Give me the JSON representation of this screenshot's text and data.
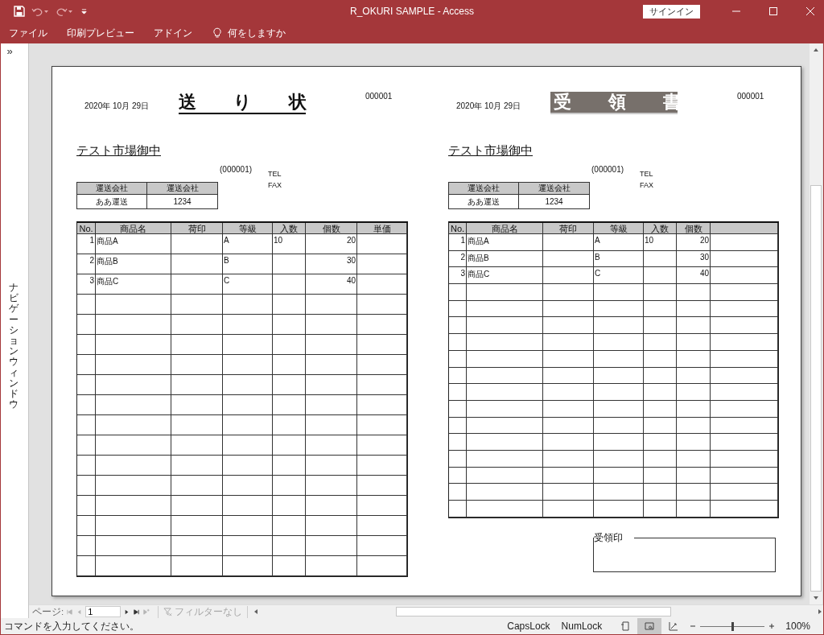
{
  "window": {
    "title": "R_OKURI SAMPLE  -  Access",
    "sign_in": "サインイン"
  },
  "menu": [
    {
      "label": "ファイル"
    },
    {
      "label": "印刷プレビュー"
    },
    {
      "label": "アドイン"
    }
  ],
  "tell_me": "何をしますか",
  "navigation_pane": {
    "toggle": "»",
    "label": "ナビゲーションウィンドウ"
  },
  "report": {
    "sheets": [
      {
        "kind": "invoice",
        "date": "2020年 10月 29日",
        "title": "送り状",
        "number": "000001",
        "recipient": "テスト市場御中",
        "code": "(000001)",
        "tel": "TEL",
        "fax": "FAX",
        "carrier": {
          "columns": [
            "運送会社",
            "運送会社"
          ],
          "values": [
            "ああ運送",
            "1234"
          ]
        },
        "items": {
          "columns": [
            "No.",
            "商品名",
            "荷印",
            "等級",
            "入数",
            "個数",
            "単価"
          ],
          "rows": [
            {
              "no": "1",
              "name": "商品A",
              "grade": "A",
              "qty": "10",
              "count": "20"
            },
            {
              "no": "2",
              "name": "商品B",
              "grade": "B",
              "count": "30"
            },
            {
              "no": "3",
              "name": "商品C",
              "grade": "C",
              "count": "40"
            },
            {},
            {},
            {},
            {},
            {},
            {},
            {},
            {},
            {},
            {},
            {},
            {},
            {},
            {}
          ]
        }
      },
      {
        "kind": "receipt",
        "date": "2020年 10月 29日",
        "title": "受領書",
        "number": "000001",
        "recipient": "テスト市場御中",
        "code": "(000001)",
        "tel": "TEL",
        "fax": "FAX",
        "carrier": {
          "columns": [
            "運送会社",
            "運送会社"
          ],
          "values": [
            "ああ運送",
            "1234"
          ]
        },
        "items": {
          "columns": [
            "No.",
            "商品名",
            "荷印",
            "等級",
            "入数",
            "個数"
          ],
          "rows": [
            {
              "no": "1",
              "name": "商品A",
              "grade": "A",
              "qty": "10",
              "count": "20"
            },
            {
              "no": "2",
              "name": "商品B",
              "grade": "B",
              "count": "30"
            },
            {
              "no": "3",
              "name": "商品C",
              "grade": "C",
              "count": "40"
            },
            {},
            {},
            {},
            {},
            {},
            {},
            {},
            {},
            {},
            {},
            {},
            {},
            {},
            {}
          ]
        },
        "stamp": "受領印"
      }
    ]
  },
  "page_nav": {
    "label": "ページ:",
    "page": "1",
    "buttons": [
      {
        "kind": "first",
        "disabled": true
      },
      {
        "kind": "previous",
        "disabled": true
      },
      {
        "kind": "next",
        "disabled": false
      },
      {
        "kind": "last",
        "disabled": false
      },
      {
        "kind": "new",
        "disabled": true
      }
    ],
    "filter": {
      "label": "フィルターなし",
      "disabled": true
    }
  },
  "status_bar": {
    "message": "コマンドを入力してください。",
    "caps_lock": "CapsLock",
    "num_lock": "NumLock",
    "views": [
      {
        "kind": "report",
        "selected": false
      },
      {
        "kind": "preview",
        "selected": true
      },
      {
        "kind": "layout",
        "selected": false
      }
    ],
    "zoom": {
      "level": 0.5,
      "reading": "100%"
    }
  }
}
